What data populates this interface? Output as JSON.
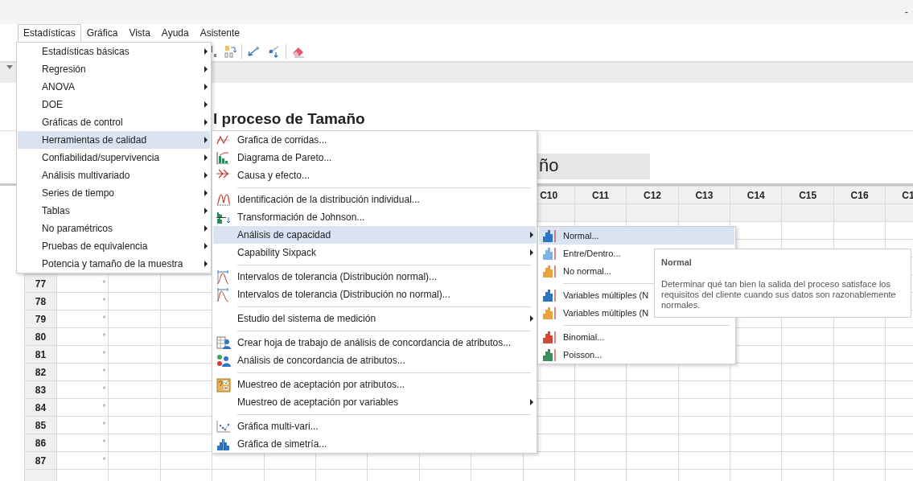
{
  "window": {
    "minimize": "-"
  },
  "menu_bar": [
    {
      "label": "Estadísticas",
      "selected": true
    },
    {
      "label": "Gráfica",
      "selected": false
    },
    {
      "label": "Vista",
      "selected": false
    },
    {
      "label": "Ayuda",
      "selected": false
    },
    {
      "label": "Asistente",
      "selected": false
    }
  ],
  "statistics_menu": {
    "items": [
      {
        "label": "Estadísticas básicas",
        "selected": false,
        "submenu": true
      },
      {
        "label": "Regresión",
        "selected": false,
        "submenu": true
      },
      {
        "label": "ANOVA",
        "selected": false,
        "submenu": true
      },
      {
        "label": "DOE",
        "selected": false,
        "submenu": true
      },
      {
        "label": "Gráficas de control",
        "selected": false,
        "submenu": true
      },
      {
        "label": "Herramientas de calidad",
        "selected": true,
        "submenu": true
      },
      {
        "label": "Confiabilidad/supervivencia",
        "selected": false,
        "submenu": true
      },
      {
        "label": "Análisis multivariado",
        "selected": false,
        "submenu": true
      },
      {
        "label": "Series de tiempo",
        "selected": false,
        "submenu": true
      },
      {
        "label": "Tablas",
        "selected": false,
        "submenu": true
      },
      {
        "label": "No paramétricos",
        "selected": false,
        "submenu": true
      },
      {
        "label": "Pruebas de equivalencia",
        "selected": false,
        "submenu": true
      },
      {
        "label": "Potencia y tamaño de la muestra",
        "selected": false,
        "submenu": true
      }
    ]
  },
  "quality_tools_menu": {
    "items": [
      {
        "kind": "item",
        "label": "Grafica de corridas...",
        "selected": false,
        "submenu": false
      },
      {
        "kind": "item",
        "label": "Diagrama de Pareto...",
        "selected": false,
        "submenu": false
      },
      {
        "kind": "item",
        "label": "Causa y efecto...",
        "selected": false,
        "submenu": false
      },
      {
        "kind": "separator"
      },
      {
        "kind": "item",
        "label": "Identificación de la distribución individual...",
        "selected": false,
        "submenu": false
      },
      {
        "kind": "item",
        "label": "Transformación de Johnson...",
        "selected": false,
        "submenu": false
      },
      {
        "kind": "item",
        "label": "Análisis de capacidad",
        "selected": true,
        "submenu": true
      },
      {
        "kind": "item",
        "label": "Capability Sixpack",
        "selected": false,
        "submenu": true
      },
      {
        "kind": "separator"
      },
      {
        "kind": "item",
        "label": "Intervalos de tolerancia (Distribución normal)...",
        "selected": false,
        "submenu": false
      },
      {
        "kind": "item",
        "label": "Intervalos de tolerancia (Distribución no normal)...",
        "selected": false,
        "submenu": false
      },
      {
        "kind": "separator"
      },
      {
        "kind": "item",
        "label": "Estudio del sistema de medición",
        "selected": false,
        "submenu": true
      },
      {
        "kind": "separator"
      },
      {
        "kind": "item",
        "label": "Crear hoja de trabajo de análisis de concordancia de atributos...",
        "selected": false,
        "submenu": false
      },
      {
        "kind": "item",
        "label": "Análisis de concordancia de atributos...",
        "selected": false,
        "submenu": false
      },
      {
        "kind": "separator"
      },
      {
        "kind": "item",
        "label": "Muestreo de aceptación por atributos...",
        "selected": false,
        "submenu": false
      },
      {
        "kind": "item",
        "label": "Muestreo de aceptación por variables",
        "selected": false,
        "submenu": true
      },
      {
        "kind": "separator"
      },
      {
        "kind": "item",
        "label": "Gráfica multi-vari...",
        "selected": false,
        "submenu": false
      },
      {
        "kind": "item",
        "label": "Gráfica de simetría...",
        "selected": false,
        "submenu": false
      }
    ]
  },
  "capability_menu": {
    "items": [
      {
        "kind": "item",
        "label": "Normal...",
        "selected": true
      },
      {
        "kind": "item",
        "label": "Entre/Dentro...",
        "selected": false
      },
      {
        "kind": "item",
        "label": "No normal...",
        "selected": false
      },
      {
        "kind": "separator"
      },
      {
        "kind": "item",
        "label": "Variables múltiples (N",
        "selected": false
      },
      {
        "kind": "item",
        "label": "Variables múltiples (N",
        "selected": false
      },
      {
        "kind": "separator"
      },
      {
        "kind": "item",
        "label": "Binomial...",
        "selected": false
      },
      {
        "kind": "item",
        "label": "Poisson...",
        "selected": false
      }
    ]
  },
  "tooltip": {
    "title": "Normal",
    "text": "Determinar qué tan bien la salida del proceso satisface los requisitos del cliente cuando sus datos son razonablemente normales."
  },
  "report": {
    "heading": "l proceso de Tamaño",
    "box_text": "ño"
  },
  "worksheet": {
    "columns": [
      "C10",
      "C11",
      "C12",
      "C13",
      "C14",
      "C15",
      "C16",
      "C1"
    ],
    "rows": [
      {
        "label": "77",
        "cells": [
          "*"
        ]
      },
      {
        "label": "78",
        "cells": [
          "*"
        ]
      },
      {
        "label": "79",
        "cells": [
          "*"
        ]
      },
      {
        "label": "80",
        "cells": [
          "*"
        ]
      },
      {
        "label": "81",
        "cells": [
          "*"
        ]
      },
      {
        "label": "82",
        "cells": [
          "*"
        ]
      },
      {
        "label": "83",
        "cells": [
          "*"
        ]
      },
      {
        "label": "84",
        "cells": [
          "*"
        ]
      },
      {
        "label": "85",
        "cells": [
          "*"
        ]
      },
      {
        "label": "86",
        "cells": [
          "*"
        ]
      },
      {
        "label": "87",
        "cells": [
          "*"
        ]
      }
    ]
  }
}
